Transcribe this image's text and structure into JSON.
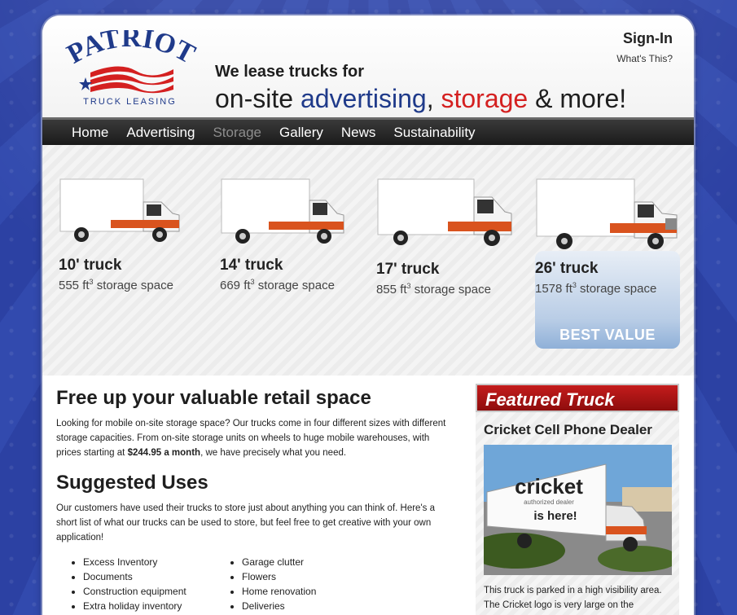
{
  "brand": {
    "name": "PATRIOT",
    "sub": "TRUCK LEASING",
    "colors": {
      "blue": "#1f3a8a",
      "red": "#d42020"
    }
  },
  "header": {
    "tag1": "We lease trucks for",
    "tag2_a": "on-site ",
    "tag2_b": "advertising",
    "tag2_c": ", ",
    "tag2_d": "storage",
    "tag2_e": " & more!",
    "signin": "Sign-In",
    "whats": "What's This?"
  },
  "nav": {
    "items": [
      {
        "label": "Home"
      },
      {
        "label": "Advertising"
      },
      {
        "label": "Storage",
        "active": true
      },
      {
        "label": "Gallery"
      },
      {
        "label": "News"
      },
      {
        "label": "Sustainability"
      }
    ]
  },
  "trucks": [
    {
      "name": "10' truck",
      "capacity": "555 ft",
      "unit_exp": "3",
      "suffix": " storage space"
    },
    {
      "name": "14' truck",
      "capacity": "669 ft",
      "unit_exp": "3",
      "suffix": " storage space"
    },
    {
      "name": "17' truck",
      "capacity": "855 ft",
      "unit_exp": "3",
      "suffix": " storage space"
    },
    {
      "name": "26' truck",
      "capacity": "1578 ft",
      "unit_exp": "3",
      "suffix": " storage space",
      "badge": "BEST VALUE"
    }
  ],
  "main": {
    "h1": "Free up your valuable retail space",
    "p1a": "Looking for mobile on-site storage space? Our trucks come in four different sizes with different storage capacities. From on-site storage units on wheels to huge mobile warehouses, with prices starting at ",
    "p1b": "$244.95 a month",
    "p1c": ", we have precisely what you need.",
    "h2": "Suggested Uses",
    "p2": "Our customers have used their trucks to store just about anything you can think of. Here's a short list of what our trucks can be used to store, but feel free to get creative with your own application!",
    "uses_col1": [
      "Excess Inventory",
      "Documents",
      "Construction equipment",
      "Extra holiday inventory"
    ],
    "uses_col2": [
      "Garage clutter",
      "Flowers",
      "Home renovation",
      "Deliveries"
    ]
  },
  "featured": {
    "header": "Featured Truck",
    "title": "Cricket Cell Phone Dealer",
    "img_text1": "cricket",
    "img_text2": "authorized dealer",
    "img_text3": "is here!",
    "text": "This truck is parked in a high visibility area. The Cricket logo is very large on the"
  }
}
